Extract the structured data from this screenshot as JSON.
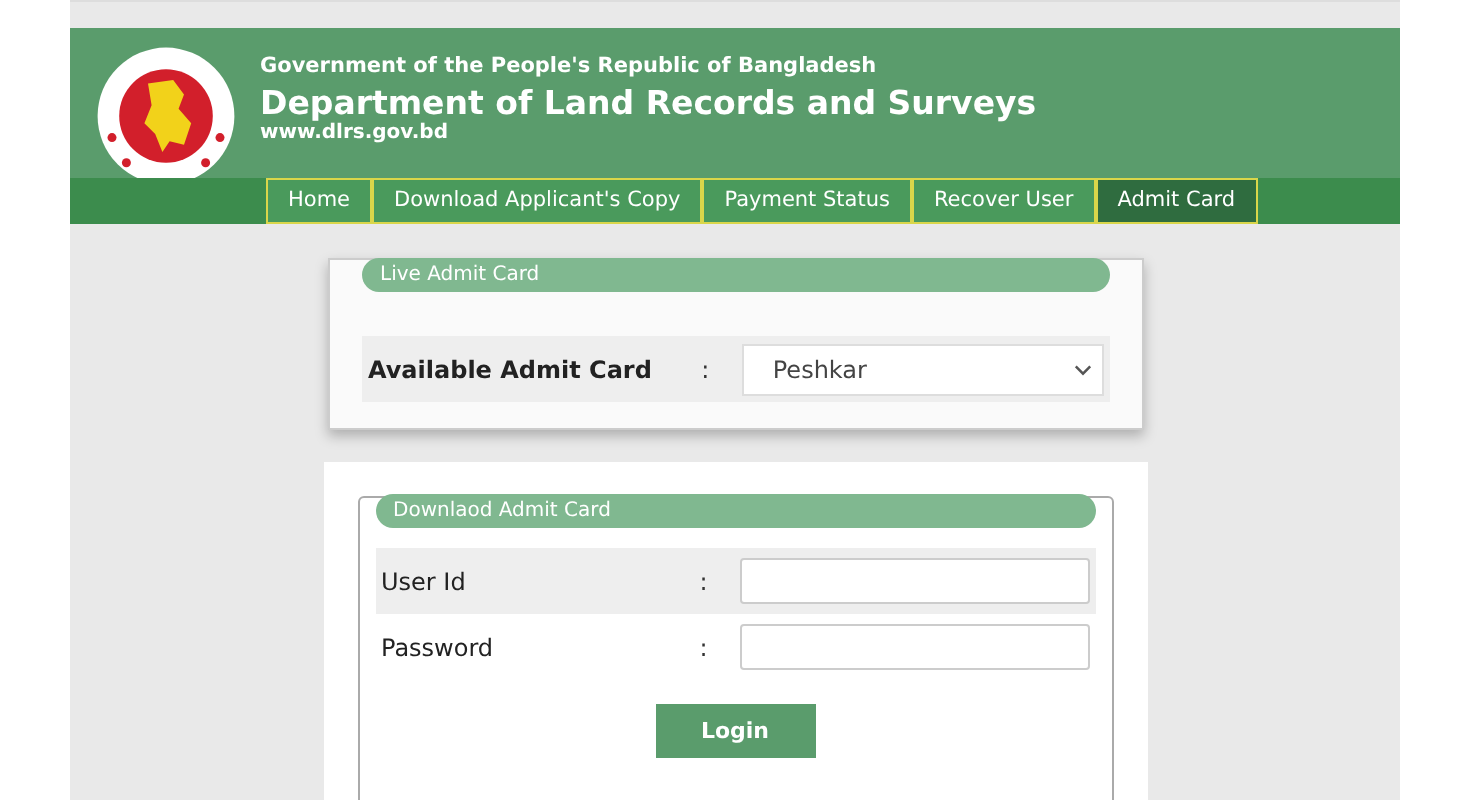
{
  "header": {
    "government": "Government of the People's Republic of Bangladesh",
    "department": "Department of Land Records and Surveys",
    "website": "www.dlrs.gov.bd"
  },
  "nav": [
    {
      "label": "Home",
      "selected": false
    },
    {
      "label": "Download Applicant's Copy",
      "selected": false
    },
    {
      "label": "Payment Status",
      "selected": false
    },
    {
      "label": "Recover User",
      "selected": false
    },
    {
      "label": "Admit Card",
      "selected": true
    }
  ],
  "live_panel": {
    "legend": "Live Admit Card",
    "label": "Available Admit Card",
    "separator": ":",
    "select_value": "Peshkar"
  },
  "download_panel": {
    "legend": "Downlaod Admit Card",
    "fields": [
      {
        "label": "User Id",
        "separator": ":"
      },
      {
        "label": "Password",
        "separator": ":"
      }
    ],
    "button": "Login"
  }
}
